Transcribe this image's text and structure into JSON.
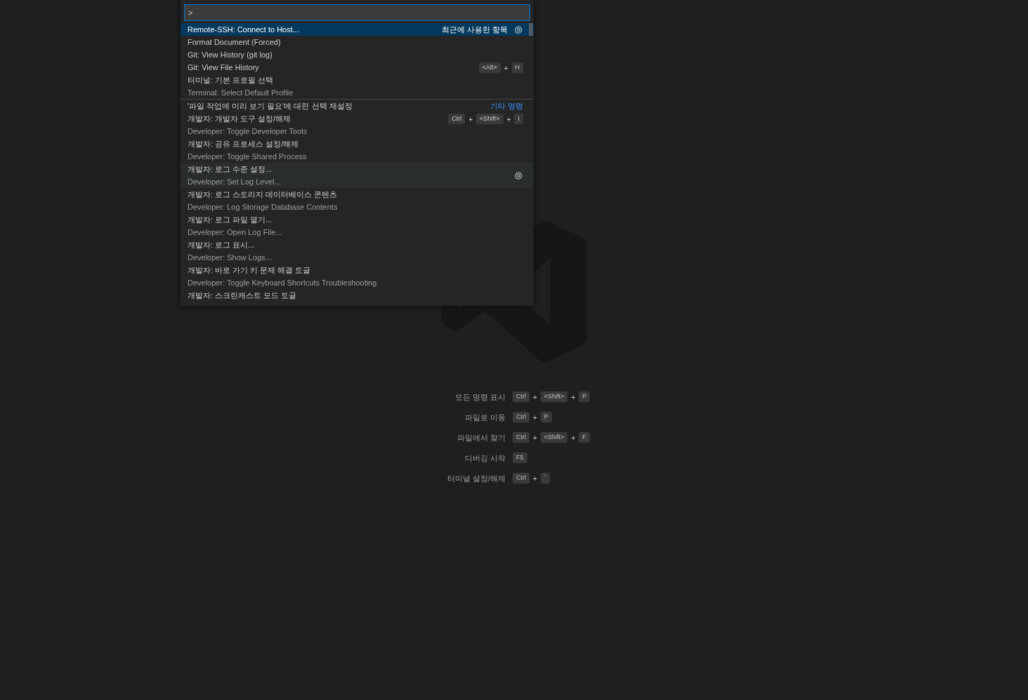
{
  "command_palette": {
    "input": {
      "value": ">"
    },
    "items": [
      {
        "label": "Remote-SSH: Connect to Host...",
        "group": "최근에 사용한 항목",
        "selected": true,
        "hovered": false,
        "separator": false
      },
      {
        "label": "Format Document (Forced)",
        "selected": false,
        "hovered": false,
        "separator": false
      },
      {
        "label": "Git: View History (git log)",
        "selected": false,
        "hovered": false,
        "separator": false
      },
      {
        "label": "Git: View File History",
        "selected": false,
        "hovered": false,
        "separator": false,
        "keybinding": [
          {
            "kind": "key",
            "text": "<Alt>"
          },
          {
            "kind": "plus",
            "text": "+"
          },
          {
            "kind": "key",
            "text": "H"
          }
        ]
      },
      {
        "label": "터미널: 기본 프로필 선택",
        "detail": "Terminal: Select Default Profile",
        "selected": false,
        "hovered": false,
        "separator": false
      },
      {
        "label": "'파일 작업에 미리 보기 필요'에 대한 선택 재설정",
        "group": "기타 명령",
        "selected": false,
        "hovered": false,
        "separator": true
      },
      {
        "label": "개발자: 개발자 도구 설정/해제",
        "detail": "Developer: Toggle Developer Tools",
        "selected": false,
        "hovered": false,
        "separator": false,
        "keybinding": [
          {
            "kind": "key",
            "text": "Ctrl"
          },
          {
            "kind": "plus",
            "text": "+"
          },
          {
            "kind": "key",
            "text": "<Shift>"
          },
          {
            "kind": "plus",
            "text": "+"
          },
          {
            "kind": "key",
            "text": "I"
          }
        ]
      },
      {
        "label": "개발자: 공유 프로세스 설정/해제",
        "detail": "Developer: Toggle Shared Process",
        "selected": false,
        "hovered": false,
        "separator": false
      },
      {
        "label": "개발자: 로그 수준 설정...",
        "detail": "Developer: Set Log Level...",
        "selected": false,
        "hovered": true,
        "separator": false
      },
      {
        "label": "개발자: 로그 스토리지 데이터베이스 콘텐츠",
        "detail": "Developer: Log Storage Database Contents",
        "selected": false,
        "hovered": false,
        "separator": false
      },
      {
        "label": "개발자: 로그 파일 열기...",
        "detail": "Developer: Open Log File...",
        "selected": false,
        "hovered": false,
        "separator": false
      },
      {
        "label": "개발자: 로그 표시...",
        "detail": "Developer: Show Logs...",
        "selected": false,
        "hovered": false,
        "separator": false
      },
      {
        "label": "개발자: 바로 가기 키 문제 해결 토글",
        "detail": "Developer: Toggle Keyboard Shortcuts Troubleshooting",
        "selected": false,
        "hovered": false,
        "separator": false
      },
      {
        "label": "개발자: 스크린캐스트 모드 토글",
        "selected": false,
        "hovered": false,
        "separator": false
      }
    ]
  },
  "shortcuts": [
    {
      "label": "모든 명령 표시",
      "keybinding": [
        {
          "kind": "key",
          "text": "Ctrl"
        },
        {
          "kind": "plus",
          "text": "+"
        },
        {
          "kind": "key",
          "text": "<Shift>"
        },
        {
          "kind": "plus",
          "text": "+"
        },
        {
          "kind": "key",
          "text": "P"
        }
      ]
    },
    {
      "label": "파일로 이동",
      "keybinding": [
        {
          "kind": "key",
          "text": "Ctrl"
        },
        {
          "kind": "plus",
          "text": "+"
        },
        {
          "kind": "key",
          "text": "P"
        }
      ]
    },
    {
      "label": "파일에서 찾기",
      "keybinding": [
        {
          "kind": "key",
          "text": "Ctrl"
        },
        {
          "kind": "plus",
          "text": "+"
        },
        {
          "kind": "key",
          "text": "<Shift>"
        },
        {
          "kind": "plus",
          "text": "+"
        },
        {
          "kind": "key",
          "text": "F"
        }
      ]
    },
    {
      "label": "디버깅 시작",
      "keybinding": [
        {
          "kind": "key",
          "text": "F5"
        }
      ]
    },
    {
      "label": "터미널 설정/해제",
      "keybinding": [
        {
          "kind": "key",
          "text": "Ctrl"
        },
        {
          "kind": "plus",
          "text": "+"
        },
        {
          "kind": "key",
          "text": "`"
        }
      ]
    }
  ]
}
